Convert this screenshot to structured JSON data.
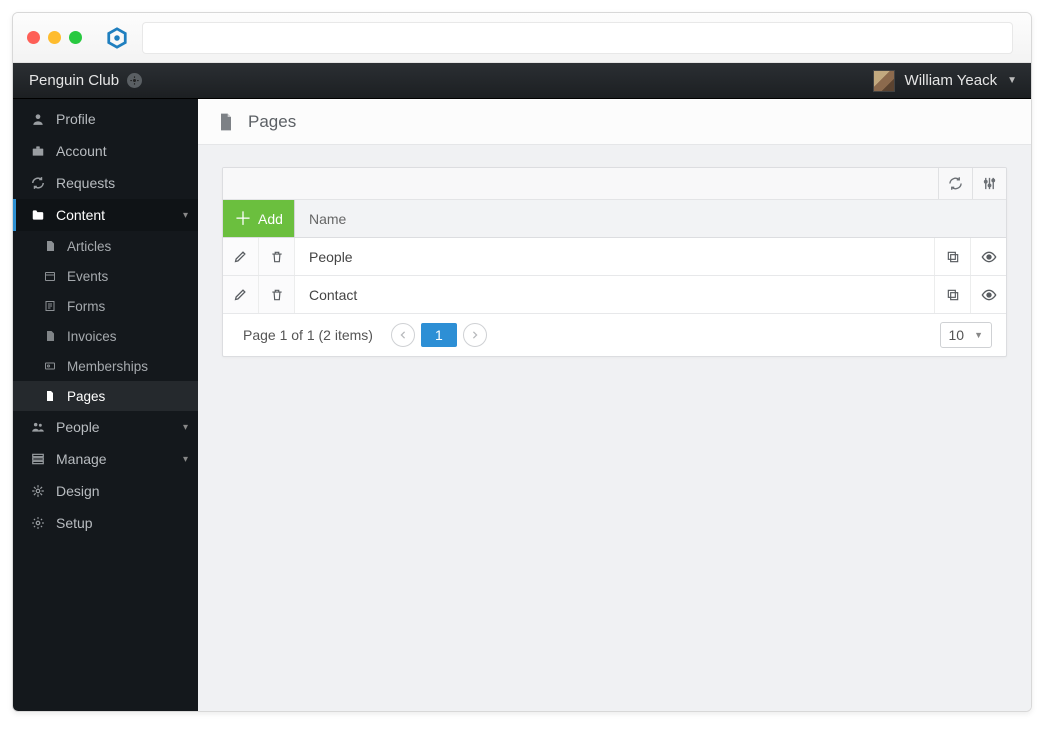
{
  "topbar": {
    "org_name": "Penguin Club",
    "user_name": "William Yeack"
  },
  "sidebar": {
    "items": [
      {
        "label": "Profile",
        "icon": "user"
      },
      {
        "label": "Account",
        "icon": "briefcase"
      },
      {
        "label": "Requests",
        "icon": "refresh"
      },
      {
        "label": "Content",
        "icon": "folder",
        "expanded": true,
        "children": [
          {
            "label": "Articles",
            "icon": "doc"
          },
          {
            "label": "Events",
            "icon": "calendar"
          },
          {
            "label": "Forms",
            "icon": "form"
          },
          {
            "label": "Invoices",
            "icon": "invoice"
          },
          {
            "label": "Memberships",
            "icon": "idcard"
          },
          {
            "label": "Pages",
            "icon": "page",
            "active": true
          }
        ]
      },
      {
        "label": "People",
        "icon": "people",
        "caret": true
      },
      {
        "label": "Manage",
        "icon": "manage",
        "caret": true
      },
      {
        "label": "Design",
        "icon": "design"
      },
      {
        "label": "Setup",
        "icon": "gear"
      }
    ]
  },
  "page": {
    "title": "Pages"
  },
  "grid": {
    "add_label": "Add",
    "name_header": "Name",
    "rows": [
      {
        "name": "People"
      },
      {
        "name": "Contact"
      }
    ],
    "footer": {
      "summary": "Page 1 of 1 (2 items)",
      "current_page": "1",
      "page_size": "10"
    }
  }
}
